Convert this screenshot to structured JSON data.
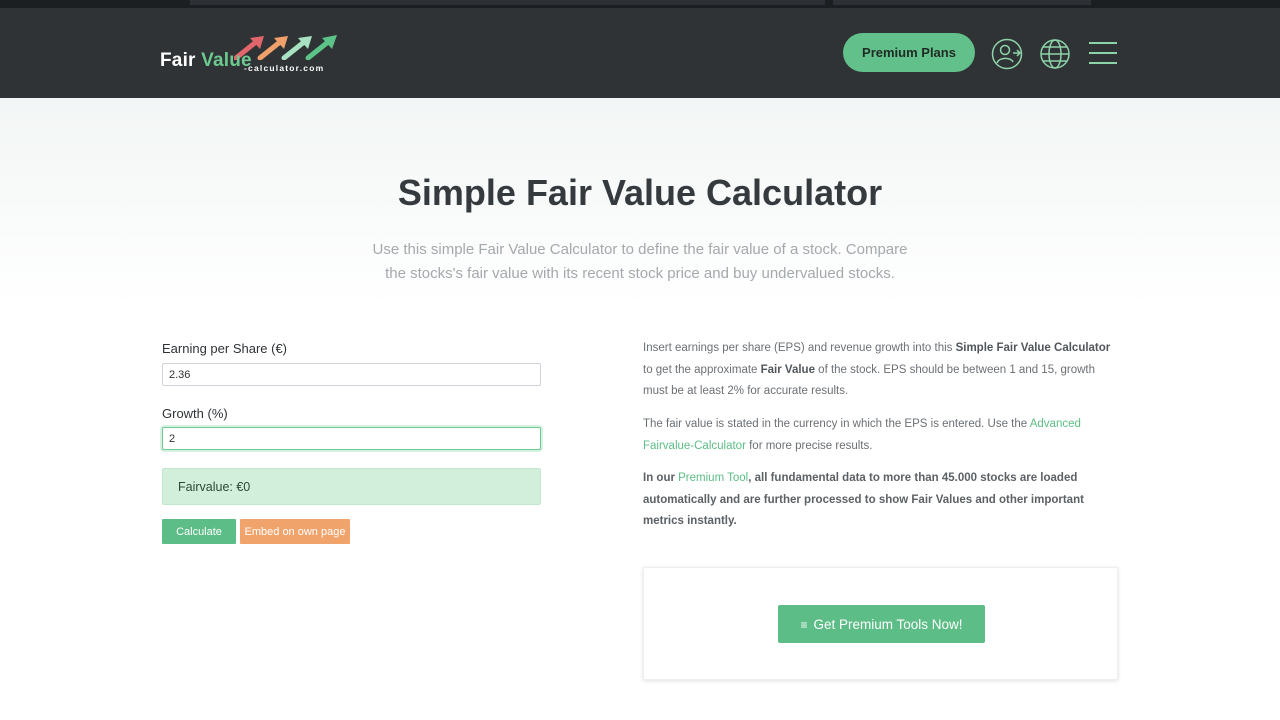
{
  "header": {
    "logo": {
      "word1": "Fair",
      "word2": "Value",
      "sub": "-calculator.com"
    },
    "premium_label": "Premium Plans",
    "icons": [
      "user-login-icon",
      "globe-icon",
      "hamburger-menu-icon"
    ],
    "accent": "#62c08a",
    "background": "#2f3335"
  },
  "hero": {
    "title": "Simple Fair Value Calculator",
    "subtitle": "Use this simple Fair Value Calculator to define the fair value of a stock. Compare the stocks's fair value with its recent stock price and buy undervalued stocks."
  },
  "form": {
    "eps_label": "Earning per Share (€)",
    "eps_value": "2.36",
    "growth_label": "Growth (%)",
    "growth_value": "2",
    "result_text": "Fairvalue: €0",
    "calculate_label": "Calculate",
    "embed_label": "Embed on own page"
  },
  "info": {
    "p1": {
      "a": "Insert earnings per share (EPS) and revenue growth into this ",
      "b": "Simple Fair Value Calculator",
      "c": " to get the approximate ",
      "d": "Fair Value",
      "e": " of the stock. EPS should be between 1 and 15, growth must be at least 2% for accurate results."
    },
    "p2": {
      "a": "The fair value is stated in the currency in which the EPS is entered. Use the ",
      "link": "Advanced Fairvalue-Calculator",
      "b": " for more precise results."
    },
    "p3": {
      "a": "In our ",
      "link": "Premium Tool",
      "b": ", all fundamental data to more than 45.000 stocks are loaded automatically and are further processed to show Fair Values and other important metrics instantly."
    }
  },
  "cta": {
    "icon": "≡",
    "label": "Get Premium Tools Now!"
  }
}
